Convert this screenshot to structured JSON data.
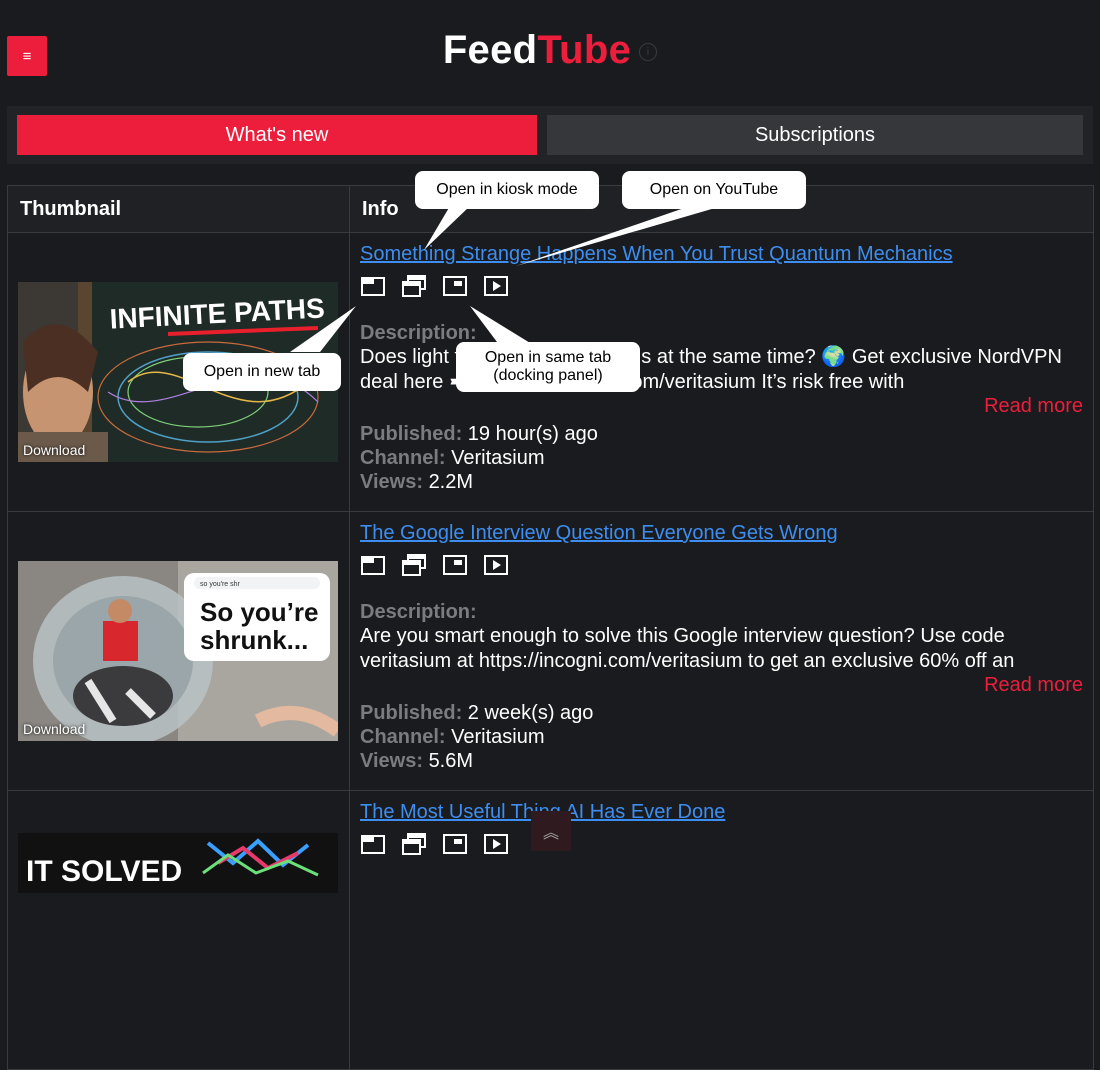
{
  "app": {
    "brand_part1": "Feed",
    "brand_part2": "Tube",
    "info_icon": "i",
    "menu_icon": "≡"
  },
  "tabs": [
    {
      "label": "What's new"
    },
    {
      "label": "Subscriptions"
    }
  ],
  "table": {
    "headers": [
      "Thumbnail",
      "Info"
    ]
  },
  "labels": {
    "description": "Description:",
    "published": "Published:",
    "channel": "Channel:",
    "views": "Views:",
    "read_more": "Read more",
    "download": "Download"
  },
  "videos": [
    {
      "title": "Something Strange Happens When You Trust Quantum Mechanics",
      "description": "Does light take all possible paths at the same time? 🌍 Get exclusive NordVPN deal here ➼ https://NordVPN.com/veritasium It’s risk free with",
      "published": "19 hour(s) ago",
      "channel": "Veritasium",
      "views": "2.2M",
      "thumb_text": "INFINITE PATHS"
    },
    {
      "title": "The Google Interview Question Everyone Gets Wrong",
      "description": "Are you smart enough to solve this Google interview question? Use code veritasium at https://incogni.com/veritasium to get an exclusive 60% off an",
      "published": "2 week(s) ago",
      "channel": "Veritasium",
      "views": "5.6M",
      "thumb_text_1": "So you’re",
      "thumb_text_2": "shrunk...",
      "thumb_search": "so you're shr"
    },
    {
      "title": "The Most Useful Thing AI Has Ever Done",
      "thumb_text": "IT SOLVED"
    }
  ],
  "callouts": {
    "kiosk": "Open in kiosk mode",
    "youtube": "Open on YouTube",
    "new_tab": "Open in new tab",
    "same_tab_1": "Open in same tab",
    "same_tab_2": "(docking panel)"
  },
  "icons": [
    "new-tab-icon",
    "kiosk-mode-icon",
    "docking-panel-icon",
    "youtube-play-icon"
  ],
  "scroll_top_icon": "︽",
  "colors": {
    "accent": "#ed1e3c",
    "link": "#3d8ef0",
    "background": "#1a1b1e",
    "muted": "#7b7c80"
  }
}
